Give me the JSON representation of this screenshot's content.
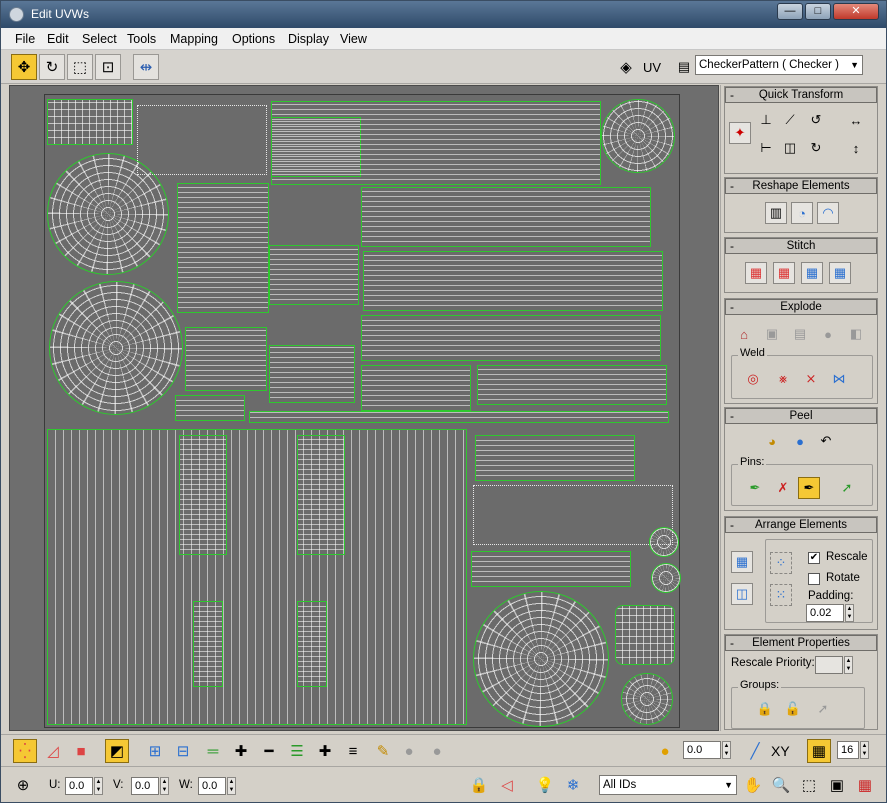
{
  "window": {
    "title": "Edit UVWs",
    "buttons": {
      "minimize": "—",
      "maximize": "□",
      "close": "✕"
    }
  },
  "menu": [
    "File",
    "Edit",
    "Select",
    "Tools",
    "Mapping",
    "Options",
    "Display",
    "View"
  ],
  "toolbar": {
    "uv_label": "UV",
    "texture_dropdown": "CheckerPattern  ( Checker )"
  },
  "panels": {
    "quick_transform": "Quick Transform",
    "reshape_elements": "Reshape Elements",
    "stitch": "Stitch",
    "explode": "Explode",
    "weld": "Weld",
    "peel": "Peel",
    "pins": "Pins:",
    "arrange_elements": "Arrange Elements",
    "rescale_label": "Rescale",
    "rescale_checked": true,
    "rotate_label": "Rotate",
    "rotate_checked": false,
    "padding_label": "Padding:",
    "padding_value": "0.02",
    "element_properties": "Element Properties",
    "rescale_priority_label": "Rescale Priority:",
    "groups_label": "Groups:"
  },
  "bottom": {
    "brush_value": "0.0",
    "xy_label": "XY",
    "grid_value": "16",
    "u_label": "U:",
    "u_value": "0.0",
    "v_label": "V:",
    "v_value": "0.0",
    "w_label": "W:",
    "w_value": "0.0",
    "ids_dropdown": "All IDs"
  },
  "colors": {
    "active_tool": "#f5c834",
    "uv_edge": "#2ec82e",
    "title_bar": "#3f5c7c"
  }
}
